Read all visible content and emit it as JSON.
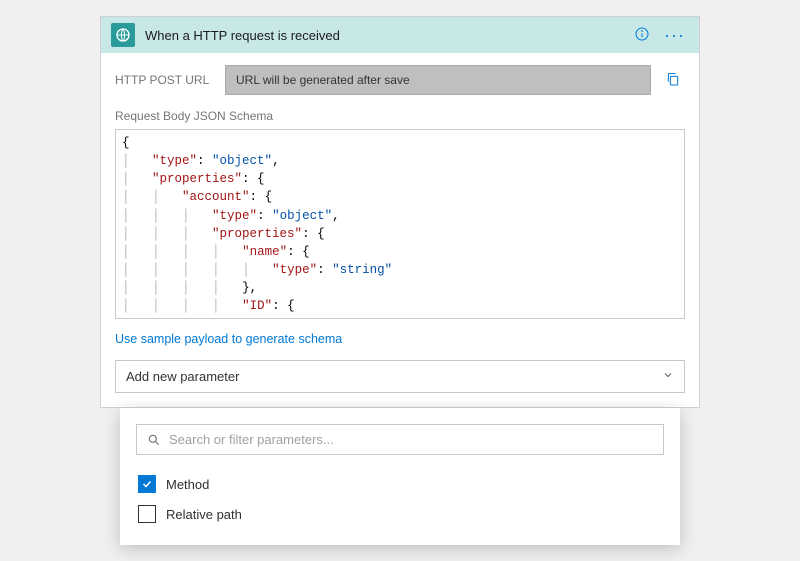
{
  "header": {
    "title": "When a HTTP request is received"
  },
  "url_row": {
    "label": "HTTP POST URL",
    "value": "URL will be generated after save"
  },
  "schema": {
    "label": "Request Body JSON Schema",
    "lines": [
      {
        "indent": 0,
        "text": "{"
      },
      {
        "indent": 1,
        "key": "\"type\"",
        "colon": ": ",
        "val": "\"object\"",
        "trail": ","
      },
      {
        "indent": 1,
        "key": "\"properties\"",
        "colon": ": ",
        "trail": "{"
      },
      {
        "indent": 2,
        "key": "\"account\"",
        "colon": ": ",
        "trail": "{"
      },
      {
        "indent": 3,
        "key": "\"type\"",
        "colon": ": ",
        "val": "\"object\"",
        "trail": ","
      },
      {
        "indent": 3,
        "key": "\"properties\"",
        "colon": ": ",
        "trail": "{"
      },
      {
        "indent": 4,
        "key": "\"name\"",
        "colon": ": ",
        "trail": "{"
      },
      {
        "indent": 5,
        "key": "\"type\"",
        "colon": ": ",
        "val": "\"string\""
      },
      {
        "indent": 4,
        "text": "},"
      },
      {
        "indent": 4,
        "key": "\"ID\"",
        "colon": ": ",
        "trail": "{"
      }
    ]
  },
  "link": {
    "text": "Use sample payload to generate schema"
  },
  "add_param": {
    "label": "Add new parameter"
  },
  "dropdown": {
    "search_placeholder": "Search or filter parameters...",
    "items": [
      {
        "label": "Method",
        "checked": true
      },
      {
        "label": "Relative path",
        "checked": false
      }
    ]
  }
}
